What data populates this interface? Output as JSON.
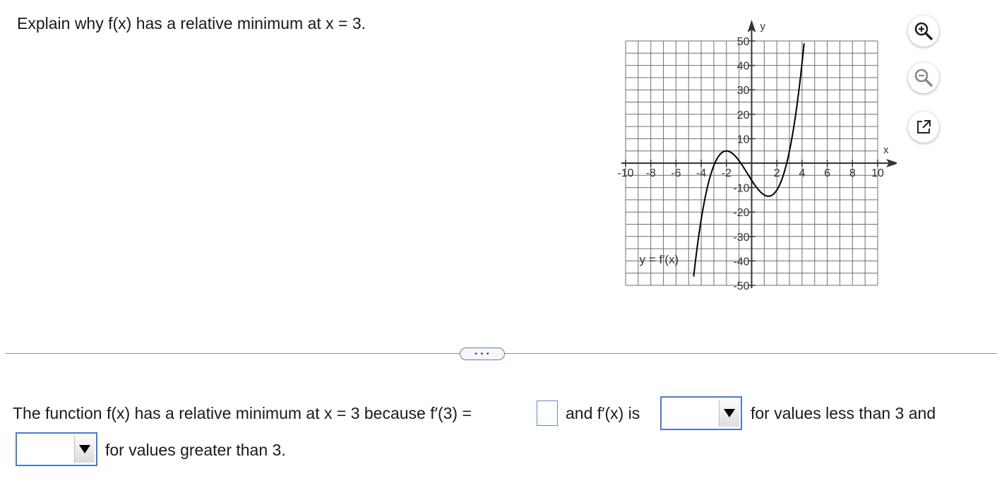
{
  "question": {
    "text": "Explain why f(x) has a relative minimum at x = 3."
  },
  "graph": {
    "x_axis_label": "x",
    "y_axis_label": "y",
    "curve_label": "y = f′(x)",
    "x_ticks": [
      "-10",
      "-8",
      "-6",
      "-4",
      "-2",
      "2",
      "4",
      "6",
      "8",
      "10"
    ],
    "y_ticks": [
      "50",
      "40",
      "30",
      "20",
      "10",
      "-10",
      "-20",
      "-30",
      "-40",
      "-50"
    ]
  },
  "chart_data": {
    "type": "line",
    "xlim": [
      -10,
      10
    ],
    "ylim": [
      -50,
      50
    ],
    "grid": true,
    "xlabel": "x",
    "ylabel": "y",
    "series": [
      {
        "name": "y = f′(x)",
        "function": "f′(x) = (x+2)^2 (x-3) + 5 (approx. cubic; local max ≈(-2,5), local min ≈(1.3,-15), zero at x = 3)",
        "points": [
          [
            -4.5,
            -50
          ],
          [
            -4,
            -23
          ],
          [
            -3,
            -1
          ],
          [
            -2,
            5
          ],
          [
            -1,
            -3
          ],
          [
            0,
            -7
          ],
          [
            1,
            -13
          ],
          [
            1.3,
            -15
          ],
          [
            2,
            -11
          ],
          [
            3,
            0
          ],
          [
            4,
            25
          ],
          [
            4.5,
            50
          ]
        ]
      }
    ]
  },
  "toolbar": {
    "zoom_in_icon": "zoom-in-icon",
    "zoom_out_icon": "zoom-out-icon",
    "popout_icon": "external-link-icon"
  },
  "more_button": {
    "label": "• • •"
  },
  "answer": {
    "part1": "The function f(x) has a relative minimum at x = 3 because f′(3) =",
    "input_value": "",
    "part2": "and f′(x) is",
    "dropdown1_selected": "",
    "part3": "for values less than 3 and",
    "dropdown2_selected": "",
    "part4": "for values greater than 3."
  },
  "colors": {
    "accent": "#4a7cc7",
    "grid": "#6f6f6f",
    "text": "#1a1a1a"
  }
}
